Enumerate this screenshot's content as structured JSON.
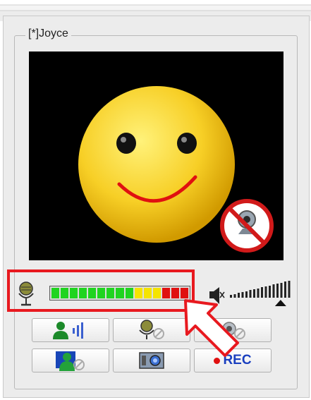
{
  "window": {
    "user_label": "[*]Joyce"
  },
  "video": {
    "status": "camera-off",
    "avatar": "smiley-face",
    "overlay_icon": "no-webcam-icon"
  },
  "audio": {
    "mic_level_segments": 15,
    "meter_colors": [
      "#1fd41f",
      "#1fd41f",
      "#1fd41f",
      "#1fd41f",
      "#1fd41f",
      "#1fd41f",
      "#1fd41f",
      "#1fd41f",
      "#1fd41f",
      "#f5e400",
      "#f5e400",
      "#f5e400",
      "#e01010",
      "#e01010",
      "#e01010"
    ],
    "volume_level": 0.75
  },
  "buttons": {
    "row1": [
      "talk-button",
      "mic-disabled-button",
      "webcam-disabled-button"
    ],
    "row2": [
      "user-video-button",
      "snapshot-button",
      "record-button"
    ],
    "record_label": "REC"
  },
  "colors": {
    "highlight": "#e8191f",
    "rec_text": "#1a3fbf"
  }
}
